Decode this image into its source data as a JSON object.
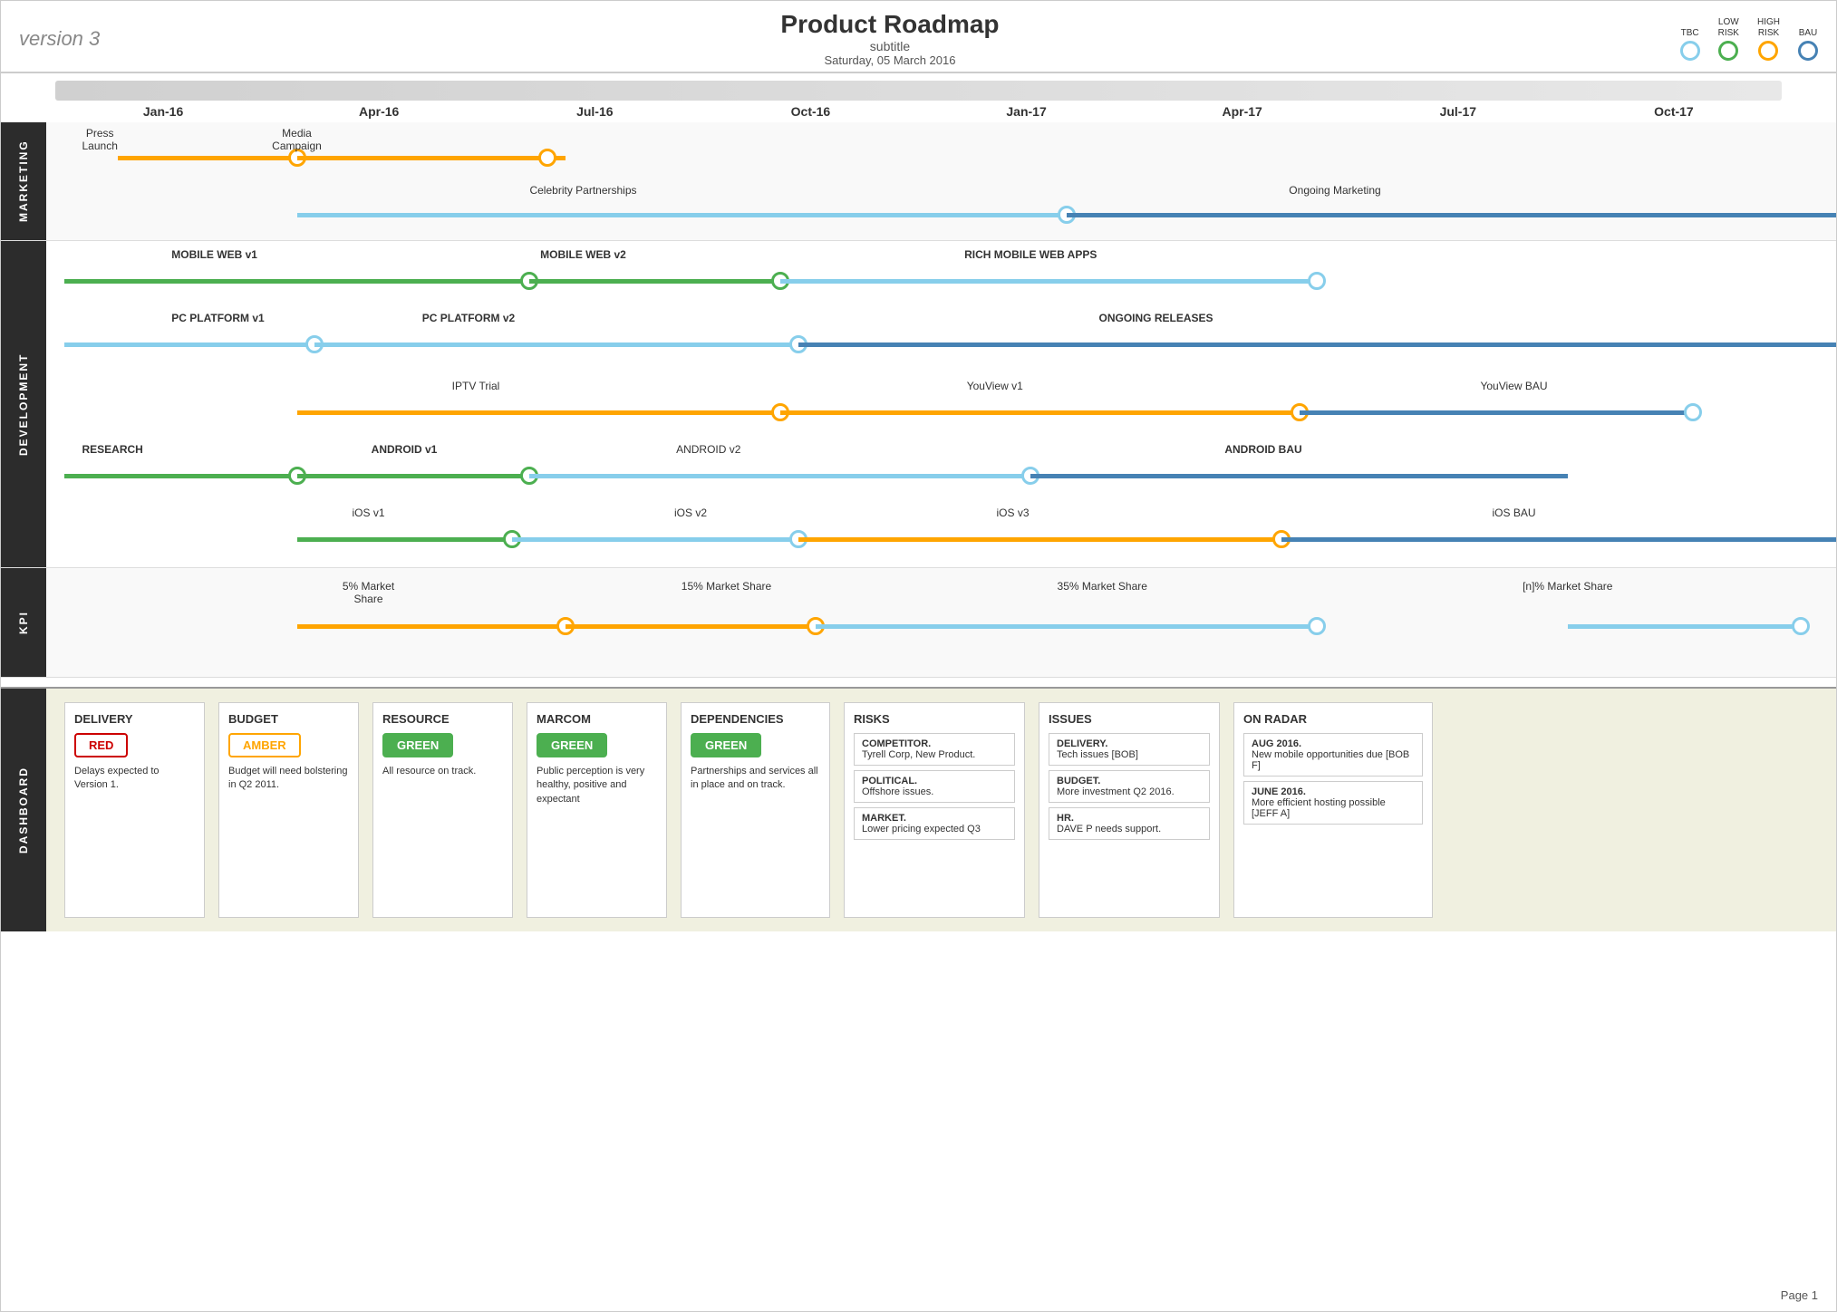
{
  "header": {
    "version": "version 3",
    "title": "Product Roadmap",
    "subtitle": "subtitle",
    "date": "Saturday, 05 March 2016"
  },
  "legend": {
    "items": [
      {
        "label": "TBC",
        "style": "tbc"
      },
      {
        "label_top": "LOW\nRISK",
        "label": "LOW RISK",
        "style": "low"
      },
      {
        "label_top": "HIGH\nRISK",
        "label": "HIGH RISK",
        "style": "high"
      },
      {
        "label": "BAU",
        "style": "bau"
      }
    ]
  },
  "timeline": {
    "labels": [
      "Jan-16",
      "Apr-16",
      "Jul-16",
      "Oct-16",
      "Jan-17",
      "Apr-17",
      "Jul-17",
      "Oct-17"
    ]
  },
  "sections": {
    "marketing": {
      "label": "MARKETING",
      "lanes": [
        {
          "label": "Press\nLaunch",
          "label_pos": 2.5,
          "line_start": 2.5,
          "line_end": 15,
          "line_color": "orange",
          "circles": [
            {
              "pos": 15,
              "style": "orange"
            }
          ]
        },
        {
          "label": "Media\nCampaign",
          "label_pos": 15,
          "line_start": 15,
          "line_end": 36,
          "line_color": "orange",
          "circles": [
            {
              "pos": 30,
              "style": "orange"
            }
          ],
          "label2": "Celebrity Partnerships",
          "label2_pos": 36
        },
        {
          "label": "Ongoing Marketing",
          "label_pos": 62,
          "line_start": 36,
          "line_end": 100,
          "line_color": "lightblue",
          "circles": [
            {
              "pos": 58,
              "style": "lightblue"
            }
          ]
        }
      ]
    }
  },
  "dashboard": {
    "cards": [
      {
        "title": "DELIVERY",
        "badge": "RED",
        "badge_style": "badge-red",
        "text": "Delays expected to Version 1."
      },
      {
        "title": "BUDGET",
        "badge": "AMBER",
        "badge_style": "badge-amber",
        "text": "Budget will need bolstering in Q2 2011."
      },
      {
        "title": "RESOURCE",
        "badge": "GREEN",
        "badge_style": "badge-green",
        "text": "All resource on track."
      },
      {
        "title": "MARCOM",
        "badge": "GREEN",
        "badge_style": "badge-green",
        "text": "Public perception is very healthy, positive and expectant"
      },
      {
        "title": "DEPENDENCIES",
        "badge": "GREEN",
        "badge_style": "badge-green",
        "text": "Partnerships and services all in place and on track."
      }
    ],
    "risks": {
      "title": "RISKS",
      "items": [
        {
          "title": "COMPETITOR.",
          "text": "Tyrell Corp, New Product."
        },
        {
          "title": "POLITICAL.",
          "text": "Offshore issues."
        },
        {
          "title": "MARKET.",
          "text": "Lower pricing expected Q3"
        }
      ]
    },
    "issues": {
      "title": "ISSUES",
      "items": [
        {
          "title": "DELIVERY.",
          "text": "Tech issues [BOB]"
        },
        {
          "title": "BUDGET.",
          "text": "More investment Q2 2016."
        },
        {
          "title": "HR.",
          "text": "DAVE P needs support."
        }
      ]
    },
    "radar": {
      "title": "ON RADAR",
      "items": [
        {
          "date": "AUG 2016.",
          "text": "New mobile opportunities due [BOB F]"
        },
        {
          "date": "JUNE 2016.",
          "text": "More efficient hosting possible [JEFF A]"
        }
      ]
    }
  },
  "footer": {
    "page": "Page 1"
  }
}
